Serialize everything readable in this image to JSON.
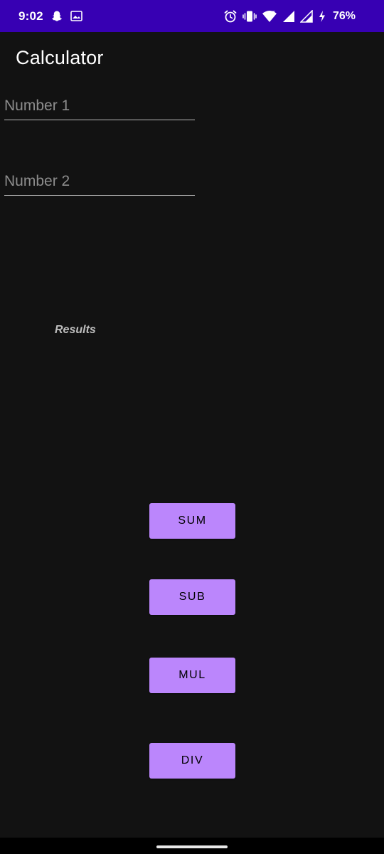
{
  "status_bar": {
    "time": "9:02",
    "battery": "76%",
    "background": "#3700B3",
    "left_icons": [
      "snapchat-icon",
      "image-icon"
    ],
    "right_icons": [
      "alarm-icon",
      "vibrate-icon",
      "wifi-icon",
      "signal-icon",
      "signal-icon",
      "charging-icon"
    ]
  },
  "app": {
    "title": "Calculator",
    "background": "#121212"
  },
  "inputs": {
    "number1": {
      "value": "",
      "placeholder": "Number 1"
    },
    "number2": {
      "value": "",
      "placeholder": "Number 2"
    }
  },
  "results": {
    "label": "Results"
  },
  "buttons": {
    "accent": "#BB86FC",
    "sum": "SUM",
    "sub": "SUB",
    "mul": "MUL",
    "div": "DIV"
  }
}
